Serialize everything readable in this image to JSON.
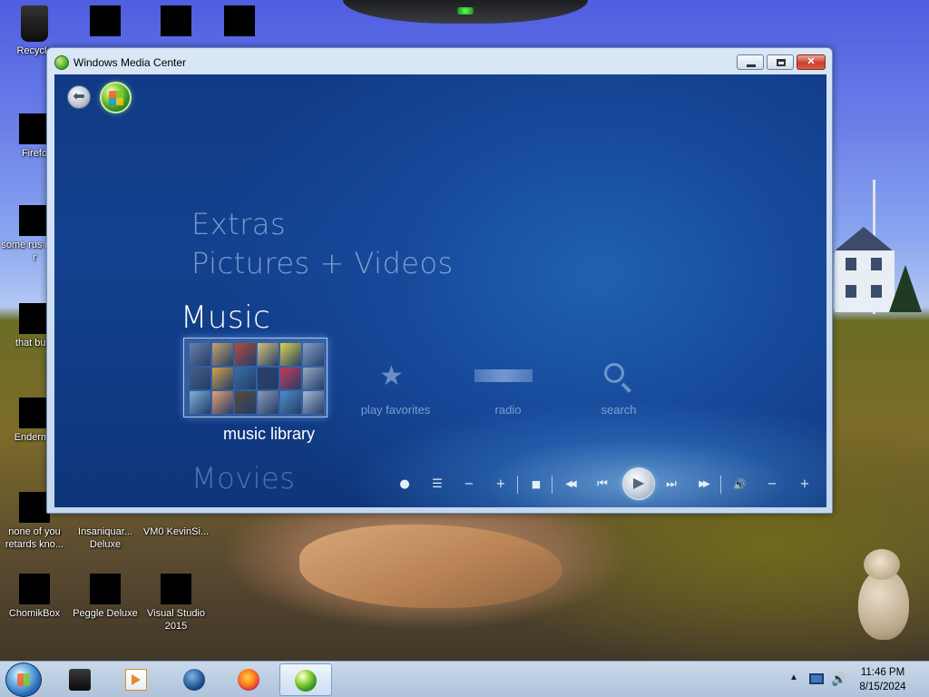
{
  "desktop": {
    "icons": [
      {
        "label": "Recycle"
      },
      {
        "label": "Firefo"
      },
      {
        "label": "some rus ran a r"
      },
      {
        "label": "that but i"
      },
      {
        "label": "Enderma"
      },
      {
        "label": "none of you retards kno..."
      },
      {
        "label": "Insaniquar... Deluxe"
      },
      {
        "label": "VM0 KevinSi..."
      },
      {
        "label": "ChomikBox"
      },
      {
        "label": "Peggle Deluxe"
      },
      {
        "label": "Visual Studio 2015"
      }
    ]
  },
  "window": {
    "title": "Windows Media Center",
    "minimize_label": "",
    "maximize_label": "",
    "close_label": "✕"
  },
  "media_center": {
    "menu": {
      "extras": "Extras",
      "pictures": "Pictures + Videos",
      "music": "Music",
      "movies": "Movies"
    },
    "strip": {
      "library": "music library",
      "favorites": "play favorites",
      "radio": "radio",
      "search": "search"
    },
    "transport": {
      "record": "●",
      "guide": "☰",
      "channel_down": "−",
      "channel_up": "+",
      "stop": "■",
      "rewind": "◀◀",
      "previous": "⏮",
      "play": "▶",
      "next": "⏭",
      "fast_forward": "▶▶",
      "mute": "🔊",
      "volume_down": "−",
      "volume_up": "+"
    },
    "album_colors": [
      "#6a7fa8",
      "#c9a26b",
      "#b84a3a",
      "#d8c07a",
      "#e2d24a",
      "#8aa0c4",
      "#4a5f86",
      "#d4a24a",
      "#3a6ea8",
      "#2c3e6a",
      "#c73a5a",
      "#9aa8c0",
      "#7fb0d8",
      "#e8a070",
      "#5a4a3a",
      "#8a9ab8",
      "#4f8fc9",
      "#a8b8d0"
    ]
  },
  "taskbar": {
    "clock_time": "11:46 PM",
    "clock_date": "8/15/2024",
    "tray_expand": "▲",
    "tray_volume": "🔊"
  }
}
